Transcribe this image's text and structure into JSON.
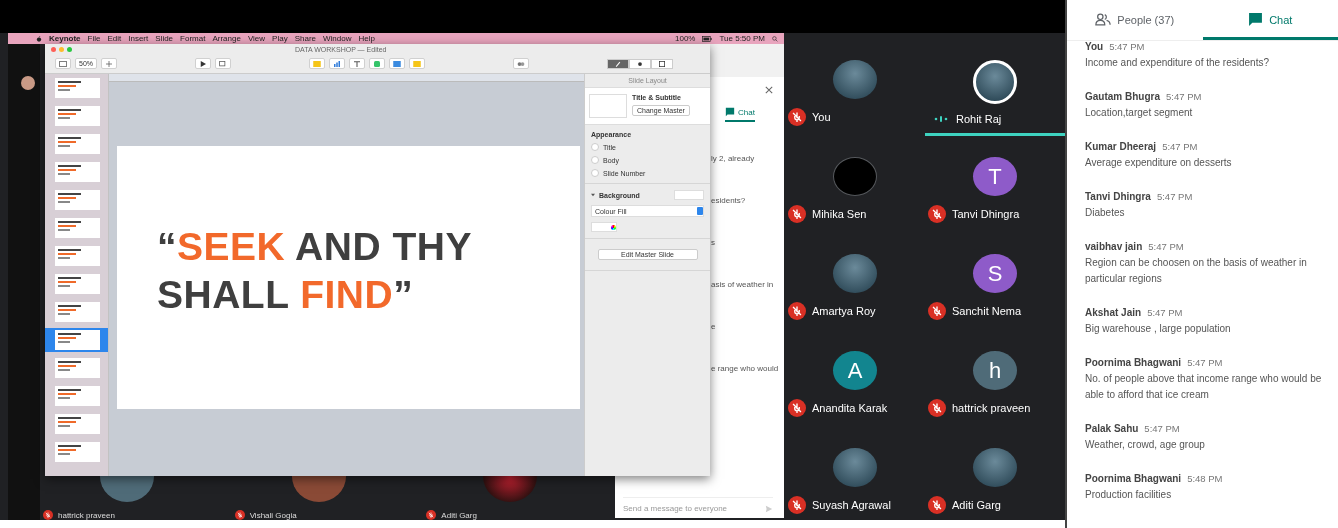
{
  "menu_bar": {
    "app": "Keynote",
    "items": [
      "File",
      "Edit",
      "Insert",
      "Slide",
      "Format",
      "Arrange",
      "View",
      "Play",
      "Share",
      "Window",
      "Help"
    ],
    "battery": "100%",
    "clock": "Tue 5:50 PM"
  },
  "keynote": {
    "title": "DATA WORKSHOP — Edited",
    "zoom": "50%",
    "thumbnails": [
      {
        "selected": false
      },
      {
        "selected": false
      },
      {
        "selected": false
      },
      {
        "selected": false
      },
      {
        "selected": false
      },
      {
        "selected": false
      },
      {
        "selected": false
      },
      {
        "selected": false
      },
      {
        "selected": false
      },
      {
        "selected": true
      },
      {
        "selected": false
      },
      {
        "selected": false
      },
      {
        "selected": false
      },
      {
        "selected": false
      }
    ],
    "slide": {
      "lines": [
        [
          {
            "text": "“",
            "accent": false
          },
          {
            "text": "SEEK",
            "accent": true
          },
          {
            "text": " AND THY",
            "accent": false
          }
        ],
        [
          {
            "text": "SHALL ",
            "accent": false
          },
          {
            "text": "FIND",
            "accent": true
          },
          {
            "text": "”",
            "accent": false
          }
        ]
      ]
    },
    "inspector": {
      "header": "Slide Layout",
      "master_name": "Title & Subtitle",
      "change_master": "Change Master",
      "appearance_label": "Appearance",
      "options": [
        {
          "label": "Title",
          "checked": false
        },
        {
          "label": "Body",
          "checked": false
        },
        {
          "label": "Slide Number",
          "checked": false
        }
      ],
      "background_label": "Background",
      "fill": "Colour Fill",
      "edit_master": "Edit Master Slide"
    }
  },
  "shared_chat": {
    "tab": "Chat",
    "fragments": [
      "ly 2, already",
      "esidents?",
      "s",
      "asis of weather in",
      "e",
      "e range who would"
    ],
    "composer_placeholder": "Send a message to everyone"
  },
  "shared_tiles": [
    {
      "name": "hattrick praveen",
      "kind": "letter",
      "color": "#4f6b78"
    },
    {
      "name": "Vishali Gogia",
      "kind": "letter",
      "color": "#8a4a36"
    },
    {
      "name": "Aditi Garg",
      "kind": "photo"
    }
  ],
  "participant_rows": [
    [
      {
        "name": "You",
        "muted": true,
        "speaking": false,
        "kind": "photo"
      },
      {
        "name": "Rohit Raj",
        "muted": false,
        "speaking": true,
        "kind": "photo"
      }
    ],
    [
      {
        "name": "Mihika Sen",
        "muted": true,
        "speaking": false,
        "kind": "dark"
      },
      {
        "name": "Tanvi Dhingra",
        "muted": true,
        "speaking": false,
        "kind": "letter",
        "letter": "T",
        "color": "#8e5bc9"
      }
    ],
    [
      {
        "name": "Amartya Roy",
        "muted": true,
        "speaking": false,
        "kind": "photo"
      },
      {
        "name": "Sanchit Nema",
        "muted": true,
        "speaking": false,
        "kind": "letter",
        "letter": "S",
        "color": "#8e5bc9"
      }
    ],
    [
      {
        "name": "Anandita Karak",
        "muted": true,
        "speaking": false,
        "kind": "letter",
        "letter": "A",
        "color": "#12858f"
      },
      {
        "name": "hattrick praveen",
        "muted": true,
        "speaking": false,
        "kind": "letter",
        "letter": "h",
        "color": "#4f6b78"
      }
    ],
    [
      {
        "name": "Suyash Agrawal",
        "muted": true,
        "speaking": false,
        "kind": "photo"
      },
      {
        "name": "Aditi Garg",
        "muted": true,
        "speaking": false,
        "kind": "photo"
      }
    ]
  ],
  "tabs": [
    {
      "label": "People (37)",
      "kind": "people",
      "selected": false
    },
    {
      "label": "Chat",
      "kind": "chat",
      "selected": true
    }
  ],
  "messages": [
    {
      "sender": "You",
      "time": "5:47 PM",
      "text": "Income and expenditure of the residents?"
    },
    {
      "sender": "Gautam Bhugra",
      "time": "5:47 PM",
      "text": "Location,target segment"
    },
    {
      "sender": "Kumar Dheeraj",
      "time": "5:47 PM",
      "text": "Average expenditure on desserts"
    },
    {
      "sender": "Tanvi Dhingra",
      "time": "5:47 PM",
      "text": "Diabetes"
    },
    {
      "sender": "vaibhav jain",
      "time": "5:47 PM",
      "text": "Region can be choosen on the basis of weather in particular regions"
    },
    {
      "sender": "Akshat Jain",
      "time": "5:47 PM",
      "text": "Big warehouse , large population"
    },
    {
      "sender": "Poornima Bhagwani",
      "time": "5:47 PM",
      "text": "No. of people above that income range who would be able to afford that ice cream"
    },
    {
      "sender": "Palak Sahu",
      "time": "5:47 PM",
      "text": "Weather, crowd, age group"
    },
    {
      "sender": "Poornima Bhagwani",
      "time": "5:48 PM",
      "text": "Production facilities"
    }
  ]
}
